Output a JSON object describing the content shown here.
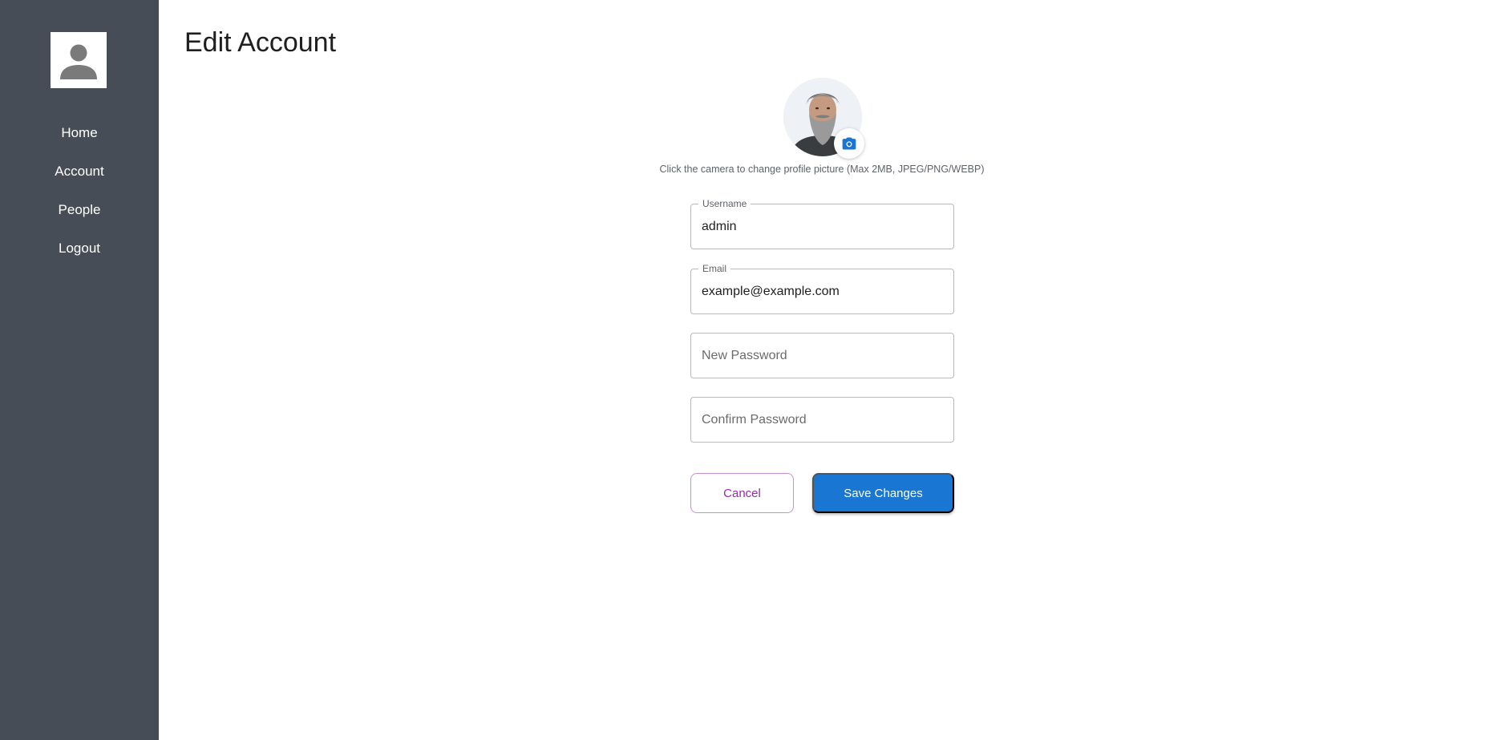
{
  "sidebar": {
    "avatar_icon": "person-icon",
    "items": [
      {
        "label": "Home"
      },
      {
        "label": "Account"
      },
      {
        "label": "People"
      },
      {
        "label": "Logout"
      }
    ]
  },
  "page": {
    "title": "Edit Account"
  },
  "profile": {
    "camera_icon": "camera-icon",
    "hint": "Click the camera to change profile picture (Max 2MB, JPEG/PNG/WEBP)"
  },
  "form": {
    "username": {
      "label": "Username",
      "value": "admin"
    },
    "email": {
      "label": "Email",
      "value": "example@example.com"
    },
    "new_password": {
      "placeholder": "New Password",
      "value": ""
    },
    "confirm_password": {
      "placeholder": "Confirm Password",
      "value": ""
    }
  },
  "actions": {
    "cancel_label": "Cancel",
    "save_label": "Save Changes"
  },
  "colors": {
    "sidebar_bg": "#474d57",
    "primary": "#1976d2",
    "secondary": "#9c27b0"
  }
}
